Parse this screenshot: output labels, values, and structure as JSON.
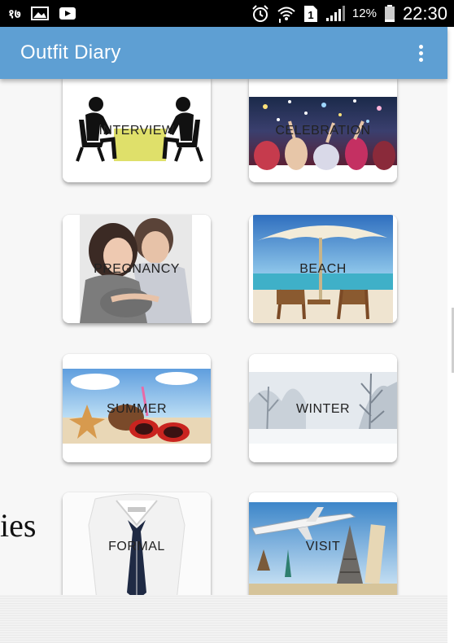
{
  "status_bar": {
    "carrier": "१७",
    "battery_percent": "12%",
    "time": "22:30",
    "icons": [
      "image-icon",
      "video-icon",
      "alarm-icon",
      "wifi-icon",
      "sim-icon",
      "signal-icon",
      "battery-icon"
    ]
  },
  "app_bar": {
    "title": "Outfit Diary",
    "menu_icon": "more-vert-icon",
    "color": "#5e9fd3"
  },
  "categories": [
    {
      "label": "INTERVIEW"
    },
    {
      "label": "CELEBRATION"
    },
    {
      "label": "PREGNANCY"
    },
    {
      "label": "BEACH"
    },
    {
      "label": "SUMMER"
    },
    {
      "label": "WINTER"
    },
    {
      "label": "FORMAL"
    },
    {
      "label": "VISIT"
    }
  ],
  "overlay_text": "ies"
}
